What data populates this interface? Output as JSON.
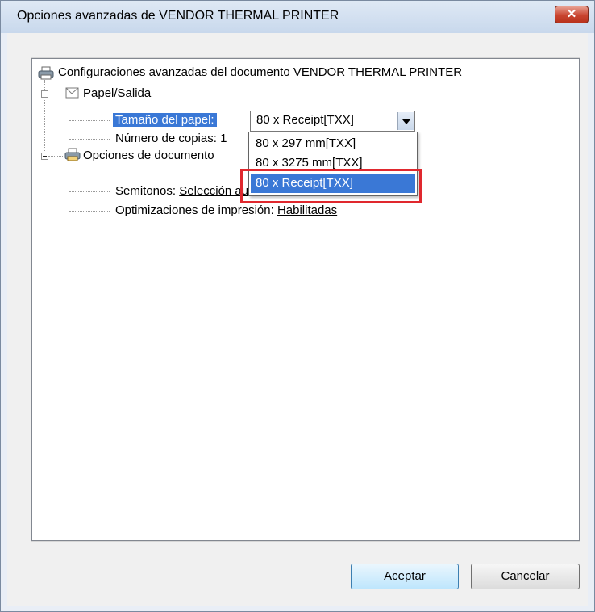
{
  "window": {
    "title": "Opciones avanzadas de VENDOR THERMAL PRINTER",
    "close_label": "✕"
  },
  "tree": {
    "root_label": "Configuraciones avanzadas del documento VENDOR THERMAL PRINTER",
    "paper_output": {
      "label": "Papel/Salida",
      "paper_size_label": "Tamaño del papel:",
      "paper_size_value": "80 x Receipt[TXX]",
      "copies_label": "Número de copias: 1"
    },
    "document_options": {
      "label": "Opciones de documento",
      "halftone_label": "Semitonos:",
      "halftone_value": "Selección automática",
      "optimizations_label": "Optimizaciones de impresión:",
      "optimizations_value": "Habilitadas"
    }
  },
  "dropdown": {
    "options": [
      "80 x 297 mm[TXX]",
      "80 x 3275 mm[TXX]",
      "80 x Receipt[TXX]"
    ],
    "selected_index": 2
  },
  "buttons": {
    "ok_label": "Aceptar",
    "cancel_label": "Cancelar"
  },
  "colors": {
    "selection": "#3a78d6",
    "highlight_box": "#e0282e"
  },
  "icons": [
    "printer-icon",
    "paper-icon",
    "document-options-icon"
  ]
}
